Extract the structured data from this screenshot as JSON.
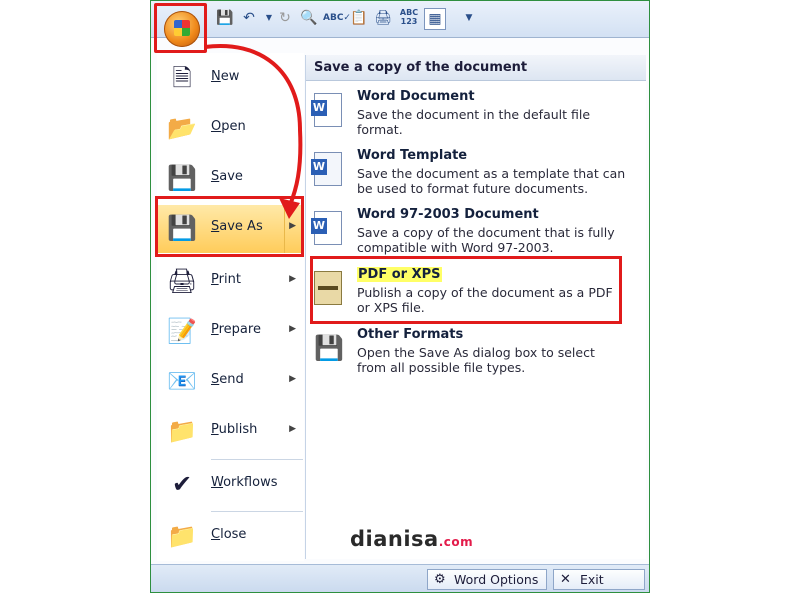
{
  "qat": {
    "icons": [
      "office-button",
      "save-icon",
      "undo-icon",
      "redo-icon",
      "print-preview-icon",
      "spelling-icon",
      "copy-icon",
      "print-icon",
      "word-count-icon",
      "table-icon",
      "customize-icon"
    ]
  },
  "menu": {
    "items": [
      {
        "label": "New"
      },
      {
        "label": "Open"
      },
      {
        "label": "Save"
      },
      {
        "label": "Save As"
      },
      {
        "label": "Print"
      },
      {
        "label": "Prepare"
      },
      {
        "label": "Send"
      },
      {
        "label": "Publish"
      },
      {
        "label": "Workflows"
      },
      {
        "label": "Close"
      }
    ]
  },
  "panel": {
    "header": "Save a copy of the document",
    "options": [
      {
        "title": "Word Document",
        "desc": "Save the document in the default file format."
      },
      {
        "title": "Word Template",
        "desc": "Save the document as a template that can be used to format future documents."
      },
      {
        "title": "Word 97-2003 Document",
        "desc": "Save a copy of the document that is fully compatible with Word 97-2003."
      },
      {
        "title": "PDF or XPS",
        "desc": "Publish a copy of the document as a PDF or XPS file."
      },
      {
        "title": "Other Formats",
        "desc": "Open the Save As dialog box to select from all possible file types."
      }
    ]
  },
  "watermark": {
    "text": "dianisa",
    "suffix": ".com"
  },
  "bottom": {
    "word_options": "Word Options",
    "exit_word": "Exit Word"
  },
  "colors": {
    "highlight_red": "#e11b1b",
    "saveas_hover": "#ffcc5a",
    "pdf_highlight": "#ffff66"
  }
}
